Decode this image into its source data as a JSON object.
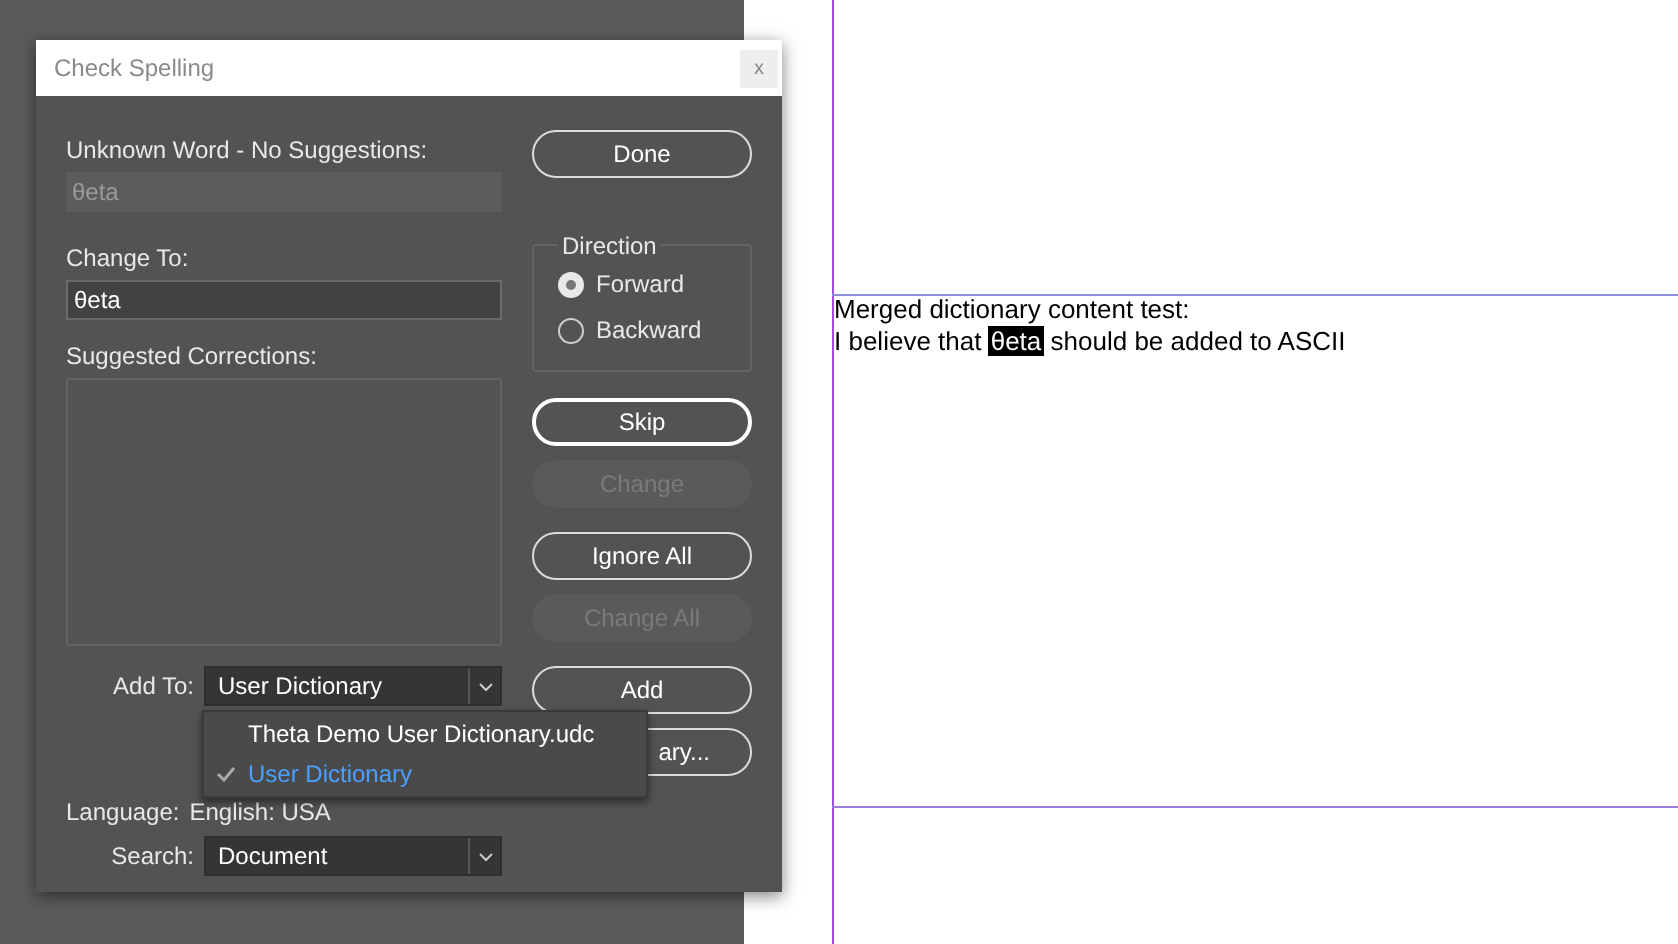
{
  "dialog": {
    "title": "Check Spelling",
    "close": "x",
    "unknown_word": {
      "label": "Unknown Word - No Suggestions:",
      "value": "θeta",
      "disabled": true
    },
    "change_to": {
      "label": "Change To:",
      "value": "θeta"
    },
    "suggested_corrections": {
      "label": "Suggested Corrections:"
    },
    "add_to": {
      "label": "Add To:",
      "value": "User Dictionary"
    },
    "add_to_menu": [
      {
        "label": "Theta Demo User Dictionary.udc",
        "selected": false
      },
      {
        "label": "User Dictionary",
        "selected": true
      }
    ],
    "language": {
      "label": "Language:",
      "value": "English: USA"
    },
    "search": {
      "label": "Search:",
      "value": "Document"
    },
    "direction": {
      "title": "Direction",
      "options": [
        {
          "label": "Forward",
          "selected": true
        },
        {
          "label": "Backward",
          "selected": false
        }
      ]
    },
    "buttons": [
      {
        "label": "Done",
        "disabled": false
      },
      {
        "label": "Skip",
        "disabled": false,
        "emphasis": true
      },
      {
        "label": "Change",
        "disabled": true
      },
      {
        "label": "Ignore All",
        "disabled": false
      },
      {
        "label": "Change All",
        "disabled": true
      },
      {
        "label": "Add",
        "disabled": false
      },
      {
        "label": "ary...",
        "disabled": false
      }
    ]
  },
  "document": {
    "lines": [
      "Merged dictionary content test:"
    ],
    "sentence": {
      "before": "I believe that",
      "highlighted": "θeta",
      "after": "should be added to ASCII"
    }
  }
}
